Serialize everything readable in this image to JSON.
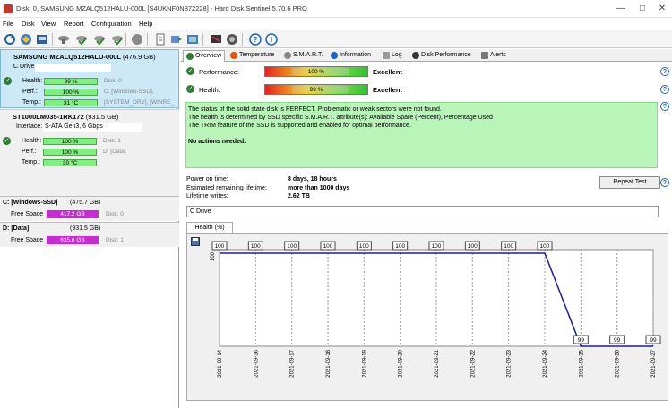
{
  "window": {
    "title": "Disk: 0, SAMSUNG MZALQ512HALU-000L [S4UKNF0N872228] - Hard Disk Sentinel 5.70.6 PRO"
  },
  "menu": [
    "File",
    "Disk",
    "View",
    "Report",
    "Configuration",
    "Help"
  ],
  "toolbar_icons": [
    "refresh-icon",
    "disk-info-icon",
    "disk-icon",
    "temperature-icon",
    "test-icon",
    "test2-icon",
    "test3-icon",
    "test4-icon",
    "shield-icon",
    "report-icon",
    "send-icon",
    "settings-icon",
    "monitor-icon",
    "alert-icon",
    "help-icon",
    "about-icon"
  ],
  "disks": [
    {
      "name": "SAMSUNG MZALQ512HALU-000L",
      "size": "(476.9 GB)",
      "drive": "C Drive",
      "health_label": "Health:",
      "health": "99 %",
      "health_side": "Disk: 0",
      "perf_label": "Perf.:",
      "perf": "100 %",
      "perf_side": "C: [Windows-SSD],",
      "temp_label": "Temp.:",
      "temp": "31 °C",
      "temp_side": "[SYSTEM_DRV],  [WINRE_"
    },
    {
      "name": "ST1000LM035-1RK172",
      "size": "(931.5 GB)",
      "interface_label": "Interface:",
      "interface": "S-ATA Gen3, 6 Gbps",
      "health_label": "Health:",
      "health": "100 %",
      "health_side": "Disk: 1",
      "perf_label": "Perf.:",
      "perf": "100 %",
      "perf_side": "D: [Data]",
      "temp_label": "Temp.:",
      "temp": "30 °C"
    }
  ],
  "volumes": [
    {
      "name": "C: [Windows-SSD]",
      "size": "(475.7 GB)",
      "free_label": "Free Space",
      "free": "417.2 GB",
      "disk": "Disk: 0"
    },
    {
      "name": "D: [Data]",
      "size": "(931.5 GB)",
      "free_label": "Free Space",
      "free": "635.6 GB",
      "disk": "Disk: 1"
    }
  ],
  "tabs": [
    "Overview",
    "Temperature",
    "S.M.A.R.T.",
    "Information",
    "Log",
    "Disk Performance",
    "Alerts"
  ],
  "overview": {
    "performance_label": "Performance:",
    "performance": "100 %",
    "performance_rating": "Excellent",
    "health_label": "Health:",
    "health": "99 %",
    "health_rating": "Excellent",
    "status_lines": [
      "The status of the solid state disk is PERFECT. Problematic or weak sectors were not found.",
      "The health is determined by SSD specific S.M.A.R.T. attribute(s):  Available Spare (Percent), Percentage Used",
      "The TRIM feature of the SSD is supported and enabled for optimal performance."
    ],
    "status_action": "No actions needed.",
    "power_on_label": "Power on time:",
    "power_on": "8 days, 18 hours",
    "remaining_label": "Estimated remaining lifetime:",
    "remaining": "more than 1000 days",
    "writes_label": "Lifetime writes:",
    "writes": "2.62 TB",
    "repeat_button": "Repeat Test",
    "drive_name": "C Drive",
    "chart_tab": "Health (%)"
  },
  "chart_data": {
    "type": "line",
    "x": [
      "2021-09-14",
      "2021-09-16",
      "2021-09-17",
      "2021-09-18",
      "2021-09-19",
      "2021-09-20",
      "2021-09-21",
      "2021-09-22",
      "2021-09-23",
      "2021-09-24",
      "2021-09-25",
      "2021-09-26",
      "2021-09-27"
    ],
    "values": [
      100,
      100,
      100,
      100,
      100,
      100,
      100,
      100,
      100,
      100,
      99,
      99,
      99
    ],
    "ytick": "100",
    "ylim": [
      99,
      100
    ],
    "grid": true,
    "line_color": "#1a1aa6"
  }
}
